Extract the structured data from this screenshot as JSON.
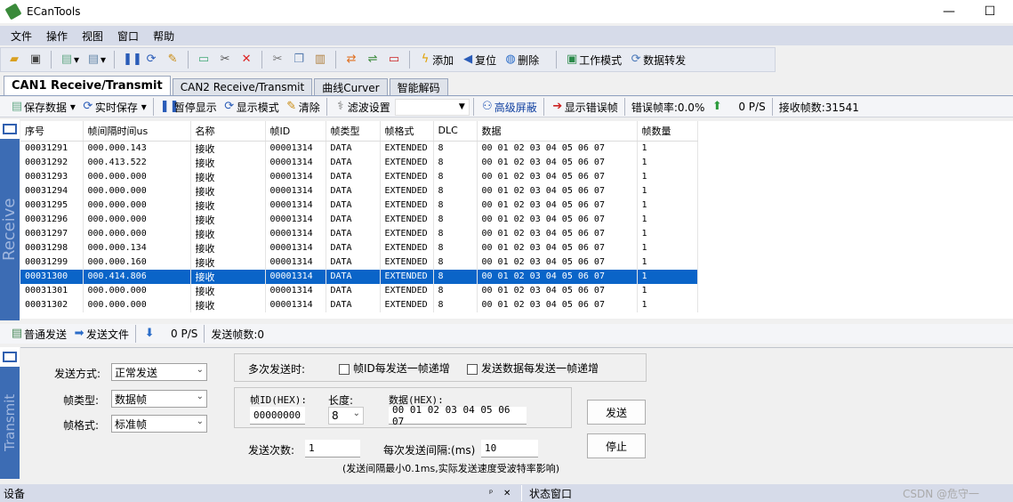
{
  "window": {
    "title": "ECanTools",
    "minimize": "—",
    "maximize": "☐"
  },
  "menu": [
    "文件",
    "操作",
    "视图",
    "窗口",
    "帮助"
  ],
  "toolbar": {
    "add": "添加",
    "reset": "复位",
    "delete": "删除",
    "work_mode": "工作模式",
    "data_forward": "数据转发"
  },
  "tabs": [
    "CAN1 Receive/Transmit",
    "CAN2 Receive/Transmit",
    "曲线Curver",
    "智能解码"
  ],
  "receive_bar": {
    "save_data": "保存数据",
    "realtime_save": "实时保存",
    "pause": "暂停显示",
    "display_mode": "显示模式",
    "clear": "清除",
    "filter": "滤波设置",
    "filter_value": "",
    "advanced_mask": "高级屏蔽",
    "show_error": "显示错误帧",
    "error_rate": "错误帧率:0.0%",
    "rate": "0 P/S",
    "rx_count": "接收帧数:31541"
  },
  "receive_label": "Receive",
  "transmit_label": "Transmit",
  "grid": {
    "columns": [
      "序号",
      "帧间隔时间us",
      "名称",
      "帧ID",
      "帧类型",
      "帧格式",
      "DLC",
      "数据",
      "帧数量"
    ],
    "rows": [
      [
        "00031291",
        "000.000.143",
        "接收",
        "00001314",
        "DATA",
        "EXTENDED",
        "8",
        "00 01 02 03 04 05 06 07",
        "1"
      ],
      [
        "00031292",
        "000.413.522",
        "接收",
        "00001314",
        "DATA",
        "EXTENDED",
        "8",
        "00 01 02 03 04 05 06 07",
        "1"
      ],
      [
        "00031293",
        "000.000.000",
        "接收",
        "00001314",
        "DATA",
        "EXTENDED",
        "8",
        "00 01 02 03 04 05 06 07",
        "1"
      ],
      [
        "00031294",
        "000.000.000",
        "接收",
        "00001314",
        "DATA",
        "EXTENDED",
        "8",
        "00 01 02 03 04 05 06 07",
        "1"
      ],
      [
        "00031295",
        "000.000.000",
        "接收",
        "00001314",
        "DATA",
        "EXTENDED",
        "8",
        "00 01 02 03 04 05 06 07",
        "1"
      ],
      [
        "00031296",
        "000.000.000",
        "接收",
        "00001314",
        "DATA",
        "EXTENDED",
        "8",
        "00 01 02 03 04 05 06 07",
        "1"
      ],
      [
        "00031297",
        "000.000.000",
        "接收",
        "00001314",
        "DATA",
        "EXTENDED",
        "8",
        "00 01 02 03 04 05 06 07",
        "1"
      ],
      [
        "00031298",
        "000.000.134",
        "接收",
        "00001314",
        "DATA",
        "EXTENDED",
        "8",
        "00 01 02 03 04 05 06 07",
        "1"
      ],
      [
        "00031299",
        "000.000.160",
        "接收",
        "00001314",
        "DATA",
        "EXTENDED",
        "8",
        "00 01 02 03 04 05 06 07",
        "1"
      ],
      [
        "00031300",
        "000.414.806",
        "接收",
        "00001314",
        "DATA",
        "EXTENDED",
        "8",
        "00 01 02 03 04 05 06 07",
        "1"
      ],
      [
        "00031301",
        "000.000.000",
        "接收",
        "00001314",
        "DATA",
        "EXTENDED",
        "8",
        "00 01 02 03 04 05 06 07",
        "1"
      ],
      [
        "00031302",
        "000.000.000",
        "接收",
        "00001314",
        "DATA",
        "EXTENDED",
        "8",
        "00 01 02 03 04 05 06 07",
        "1"
      ]
    ],
    "selected_index": 9
  },
  "send_bar": {
    "normal_send": "普通发送",
    "send_file": "发送文件",
    "rate": "0 P/S",
    "tx_count": "发送帧数:0"
  },
  "send_form": {
    "send_mode_label": "发送方式:",
    "send_mode": "正常发送",
    "frame_type_label": "帧类型:",
    "frame_type": "数据帧",
    "frame_format_label": "帧格式:",
    "frame_format": "标准帧",
    "multi_send_label": "多次发送时:",
    "id_increment": "帧ID每发送一帧递增",
    "data_increment": "发送数据每发送一帧递增",
    "frame_id_label": "帧ID(HEX):",
    "frame_id": "00000000",
    "length_label": "长度:",
    "length": "8",
    "data_label": "数据(HEX):",
    "data": "00 01 02 03 04 05 06 07",
    "send_count_label": "发送次数:",
    "send_count": "1",
    "interval_label": "每次发送间隔:(ms)",
    "interval": "10",
    "note": "(发送间隔最小0.1ms,实际发送速度受波特率影响)",
    "send_button": "发送",
    "stop_button": "停止"
  },
  "status": {
    "device": "设备",
    "pin": "ᵖ",
    "close": "✕",
    "state_window": "状态窗口",
    "watermark": "CSDN @危守一"
  }
}
